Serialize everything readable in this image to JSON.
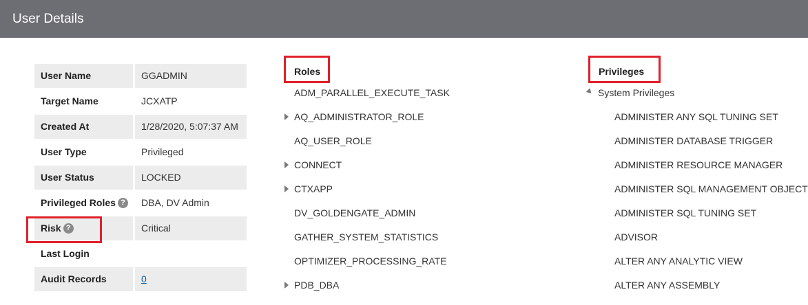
{
  "header": {
    "title": "User Details"
  },
  "details": [
    {
      "label": "User Name",
      "value": "GGADMIN"
    },
    {
      "label": "Target Name",
      "value": "JCXATP"
    },
    {
      "label": "Created At",
      "value": "1/28/2020, 5:07:37 AM"
    },
    {
      "label": "User Type",
      "value": "Privileged"
    },
    {
      "label": "User Status",
      "value": "LOCKED"
    },
    {
      "label": "Privileged Roles",
      "value": "DBA, DV Admin",
      "help": "?"
    },
    {
      "label": "Risk",
      "value": "Critical",
      "help": "?"
    },
    {
      "label": "Last Login",
      "value": ""
    },
    {
      "label": "Audit Records",
      "value": "0"
    }
  ],
  "roles": {
    "title": "Roles",
    "items": [
      {
        "label": "ADM_PARALLEL_EXECUTE_TASK",
        "expandable": false
      },
      {
        "label": "AQ_ADMINISTRATOR_ROLE",
        "expandable": true
      },
      {
        "label": "AQ_USER_ROLE",
        "expandable": false
      },
      {
        "label": "CONNECT",
        "expandable": true
      },
      {
        "label": "CTXAPP",
        "expandable": true
      },
      {
        "label": "DV_GOLDENGATE_ADMIN",
        "expandable": false
      },
      {
        "label": "GATHER_SYSTEM_STATISTICS",
        "expandable": false
      },
      {
        "label": "OPTIMIZER_PROCESSING_RATE",
        "expandable": false
      },
      {
        "label": "PDB_DBA",
        "expandable": true
      }
    ]
  },
  "privileges": {
    "title": "Privileges",
    "group_label": "System Privileges",
    "items": [
      "ADMINISTER ANY SQL TUNING SET",
      "ADMINISTER DATABASE TRIGGER",
      "ADMINISTER RESOURCE MANAGER",
      "ADMINISTER SQL MANAGEMENT OBJECT",
      "ADMINISTER SQL TUNING SET",
      "ADVISOR",
      "ALTER ANY ANALYTIC VIEW",
      "ALTER ANY ASSEMBLY"
    ]
  },
  "colors": {
    "header_bg": "#6d6e73",
    "highlight": "#e0202a",
    "link": "#0b5ea8"
  }
}
